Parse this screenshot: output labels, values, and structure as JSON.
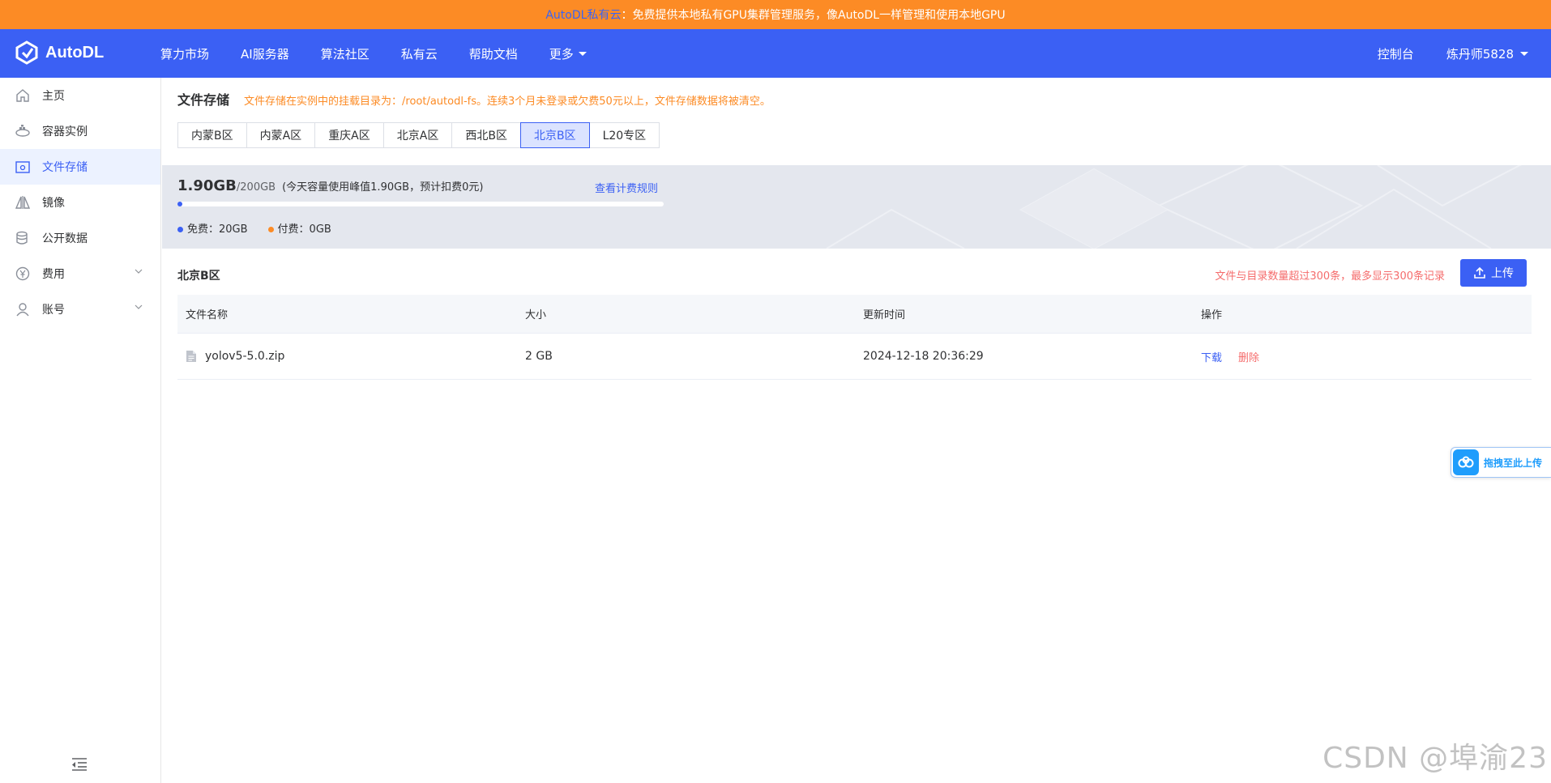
{
  "announcement": {
    "link_text": "AutoDL私有云",
    "text": "：免费提供本地私有GPU集群管理服务，像AutoDL一样管理和使用本地GPU"
  },
  "navbar": {
    "logo_text": "AutoDL",
    "items": [
      {
        "label": "算力市场"
      },
      {
        "label": "AI服务器"
      },
      {
        "label": "算法社区"
      },
      {
        "label": "私有云"
      },
      {
        "label": "帮助文档"
      },
      {
        "label": "更多"
      }
    ],
    "console_label": "控制台",
    "username": "炼丹师5828"
  },
  "sidebar": {
    "items": [
      {
        "label": "主页",
        "icon": "home-icon"
      },
      {
        "label": "容器实例",
        "icon": "container-icon"
      },
      {
        "label": "文件存储",
        "icon": "folder-icon",
        "active": true
      },
      {
        "label": "镜像",
        "icon": "mirror-icon"
      },
      {
        "label": "公开数据",
        "icon": "database-icon"
      },
      {
        "label": "费用",
        "icon": "yen-icon",
        "expandable": true
      },
      {
        "label": "账号",
        "icon": "user-icon",
        "expandable": true
      }
    ]
  },
  "page": {
    "title": "文件存储",
    "notice": "文件存储在实例中的挂载目录为：/root/autodl-fs。连续3个月未登录或欠费50元以上，文件存储数据将被清空。"
  },
  "region_tabs": {
    "items": [
      "内蒙B区",
      "内蒙A区",
      "重庆A区",
      "北京A区",
      "西北B区",
      "北京B区",
      "L20专区"
    ],
    "selected": "北京B区"
  },
  "usage": {
    "used": "1.90GB",
    "total": "/200GB",
    "note": "(今天容量使用峰值1.90GB，预计扣费0元)",
    "billing_link": "查看计费规则",
    "used_fraction": 0.0095,
    "free_label": "免费：20GB",
    "paid_label": "付费：0GB",
    "colors": {
      "free": "#3b60f4",
      "paid": "#fc8b25"
    }
  },
  "files": {
    "region_title": "北京B区",
    "limit_warning": "文件与目录数量超过300条，最多显示300条记录",
    "upload_label": "上传",
    "columns": [
      "文件名称",
      "大小",
      "更新时间",
      "操作"
    ],
    "rows": [
      {
        "name": "yolov5-5.0.zip",
        "size": "2 GB",
        "updated": "2024-12-18 20:36:29",
        "download": "下载",
        "delete": "删除"
      }
    ]
  },
  "drag_upload": {
    "label": "拖拽至此上传"
  },
  "watermark": "CSDN @埠渝23"
}
